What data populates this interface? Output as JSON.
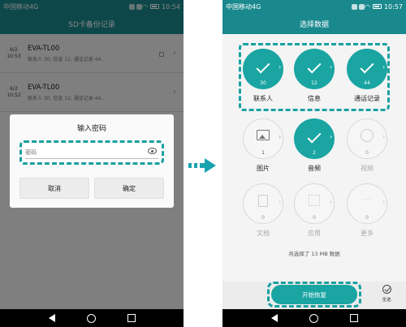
{
  "left": {
    "status": {
      "carrier": "中国移动4G",
      "time": "10:54"
    },
    "title": "SD卡备份记录",
    "records": [
      {
        "date_line1": "6/2",
        "date_line2": "10:53",
        "device": "EVA-TL00",
        "summary": "联系人 30, 信息 12, 通话记录 44..."
      },
      {
        "date_line1": "6/2",
        "date_line2": "10:52",
        "device": "EVA-TL00",
        "summary": "联系人 30, 信息 12, 通话记录 44..."
      }
    ],
    "dialog": {
      "title": "输入密码",
      "placeholder": "密码",
      "cancel": "取消",
      "confirm": "确定"
    }
  },
  "right": {
    "status": {
      "carrier": "中国移动4G",
      "time": "10:57"
    },
    "title": "选择数据",
    "tiles": [
      {
        "label": "联系人",
        "count": "30",
        "selected": true
      },
      {
        "label": "信息",
        "count": "12",
        "selected": true
      },
      {
        "label": "通话记录",
        "count": "44",
        "selected": true
      },
      {
        "label": "图片",
        "count": "1",
        "selected": false
      },
      {
        "label": "音频",
        "count": "2",
        "selected": true
      },
      {
        "label": "视频",
        "count": "0",
        "selected": false
      },
      {
        "label": "文档",
        "count": "0",
        "selected": false
      },
      {
        "label": "应用",
        "count": "0",
        "selected": false
      },
      {
        "label": "更多",
        "count": "0",
        "selected": false
      }
    ],
    "summary": "共选择了 13 MB 数据",
    "start_button": "开始恢复",
    "select_all": "全选"
  },
  "colors": {
    "accent": "#1aa5a2",
    "header": "#19898d",
    "highlight": "#18a0a0"
  }
}
